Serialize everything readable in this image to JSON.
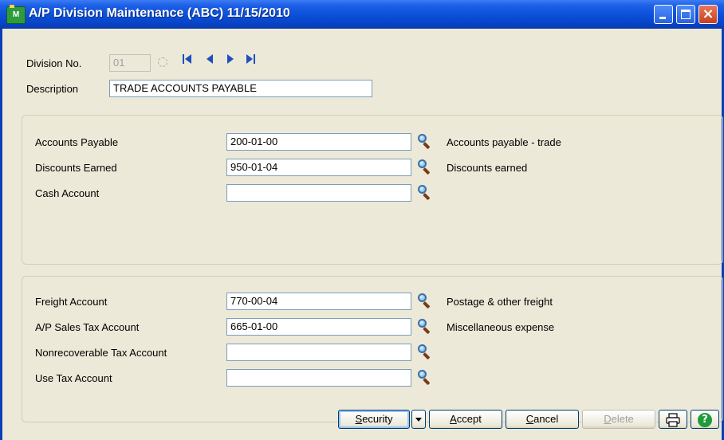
{
  "window": {
    "title": "A/P Division Maintenance (ABC) 11/15/2010",
    "app_icon_text": "M"
  },
  "header": {
    "division_label": "Division No.",
    "division_value": "01",
    "description_label": "Description",
    "description_value": "TRADE ACCOUNTS PAYABLE"
  },
  "group1": {
    "rows": [
      {
        "label": "Accounts Payable",
        "value": "200-01-00",
        "desc": "Accounts payable - trade"
      },
      {
        "label": "Discounts Earned",
        "value": "950-01-04",
        "desc": "Discounts earned"
      },
      {
        "label": "Cash Account",
        "value": "",
        "desc": ""
      }
    ]
  },
  "group2": {
    "rows": [
      {
        "label": "Freight Account",
        "value": "770-00-04",
        "desc": "Postage & other freight"
      },
      {
        "label": "A/P Sales Tax Account",
        "value": "665-01-00",
        "desc": "Miscellaneous expense"
      },
      {
        "label": "Nonrecoverable Tax Account",
        "value": "",
        "desc": ""
      },
      {
        "label": "Use Tax Account",
        "value": "",
        "desc": ""
      }
    ]
  },
  "buttons": {
    "security": {
      "first": "S",
      "rest": "ecurity"
    },
    "accept": {
      "first": "A",
      "rest": "ccept"
    },
    "cancel": {
      "first": "C",
      "rest": "ancel"
    },
    "delete": {
      "first": "D",
      "rest": "elete"
    }
  },
  "icons": {
    "lookup": "magnifier-icon",
    "print": "printer-icon",
    "help": "help-icon",
    "nav": [
      "first-record-icon",
      "previous-record-icon",
      "next-record-icon",
      "last-record-icon"
    ]
  },
  "colors": {
    "titlebar": "#0a4fd8",
    "dialog_bg": "#ece9d8",
    "nav_arrow": "#1f4fbf",
    "help_green": "#1f9b3a"
  }
}
